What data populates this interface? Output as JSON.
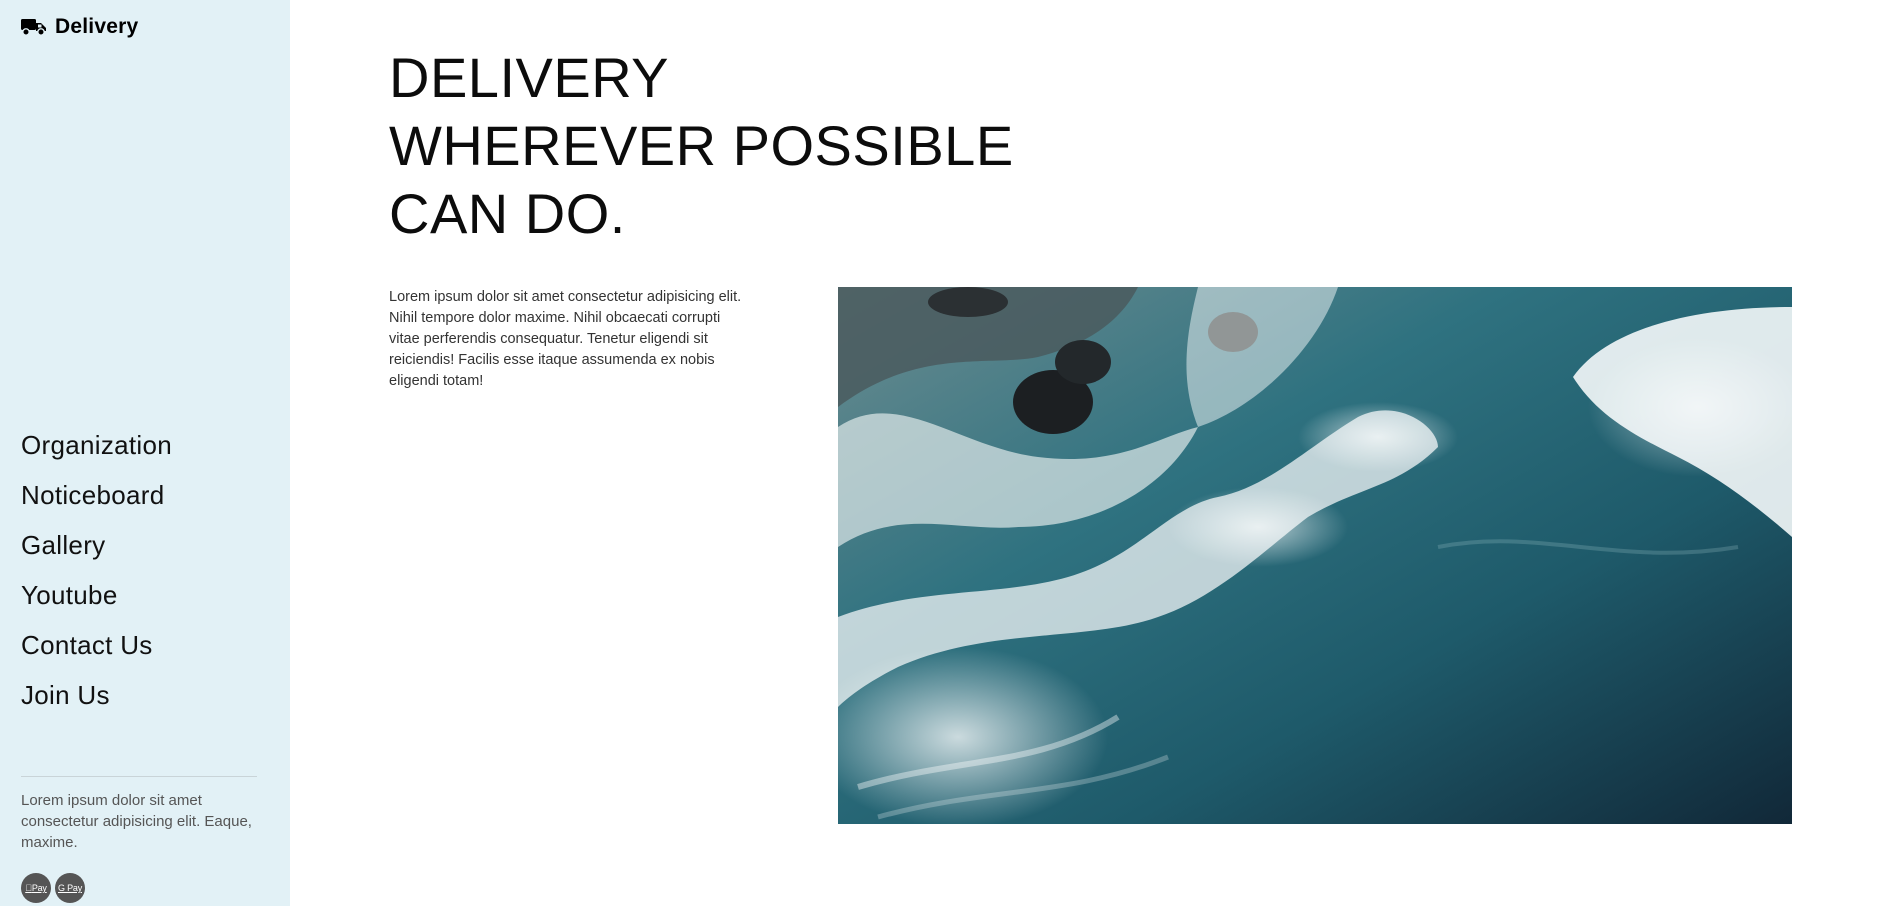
{
  "brand": {
    "name": "Delivery",
    "icon": "truck-icon"
  },
  "nav": {
    "items": [
      {
        "label": "Organization"
      },
      {
        "label": "Noticeboard"
      },
      {
        "label": "Gallery"
      },
      {
        "label": "Youtube"
      },
      {
        "label": "Contact Us"
      },
      {
        "label": "Join Us"
      }
    ]
  },
  "sidebar_footer": {
    "text": "Lorem ipsum dolor sit amet consectetur adipisicing elit. Eaque, maxime.",
    "pay_badges": [
      {
        "label": "Pay",
        "icon": "apple-pay-icon"
      },
      {
        "label": "G Pay",
        "icon": "google-pay-icon"
      }
    ]
  },
  "hero": {
    "headline_lines": [
      "DELIVERY",
      "WHEREVER POSSIBLE",
      "CAN DO."
    ],
    "paragraph": "Lorem ipsum dolor sit amet consectetur adipisicing elit. Nihil tempore dolor maxime. Nihil obcaecati corrupti vitae perferendis consequatur. Tenetur eligendi sit reiciendis! Facilis esse itaque assumenda ex nobis eligendi totam!"
  },
  "colors": {
    "sidebar_bg": "#e2f1f6",
    "text": "#111111",
    "muted": "#555555"
  }
}
